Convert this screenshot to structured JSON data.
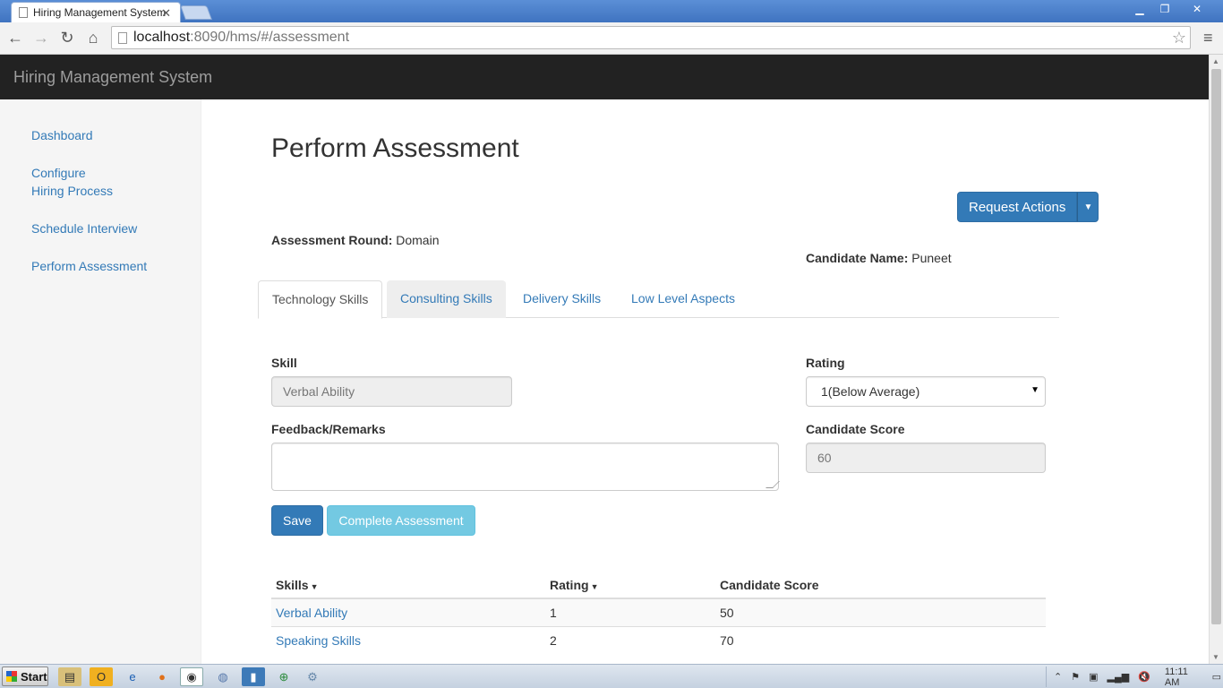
{
  "browser": {
    "tab_title": "Hiring Management System",
    "url_host": "localhost",
    "url_path": ":8090/hms/#/assessment"
  },
  "app": {
    "brand": "Hiring Management System"
  },
  "sidebar": {
    "items": [
      {
        "label": "Dashboard"
      },
      {
        "label": "Configure Hiring Process"
      },
      {
        "label": "Schedule Interview"
      },
      {
        "label": "Perform Assessment"
      }
    ]
  },
  "page": {
    "title": "Perform Assessment",
    "request_actions_label": "Request Actions",
    "assessment_round_label": "Assessment Round:",
    "assessment_round_value": "Domain",
    "candidate_name_label": "Candidate Name:",
    "candidate_name_value": "Puneet"
  },
  "tabs": [
    {
      "label": "Technology Skills",
      "active": true
    },
    {
      "label": "Consulting Skills"
    },
    {
      "label": "Delivery Skills"
    },
    {
      "label": "Low Level Aspects"
    }
  ],
  "form": {
    "skill_label": "Skill",
    "skill_value": "Verbal Ability",
    "rating_label": "Rating",
    "rating_value": "1(Below Average)",
    "feedback_label": "Feedback/Remarks",
    "feedback_value": "",
    "score_label": "Candidate Score",
    "score_value": "60",
    "save_label": "Save",
    "complete_label": "Complete Assessment"
  },
  "table": {
    "headers": [
      "Skills",
      "Rating",
      "Candidate Score"
    ],
    "rows": [
      [
        "Verbal Ability",
        "1",
        "50"
      ],
      [
        "Speaking Skills",
        "2",
        "70"
      ]
    ]
  },
  "taskbar": {
    "start_label": "Start",
    "clock": "11:11 AM"
  }
}
